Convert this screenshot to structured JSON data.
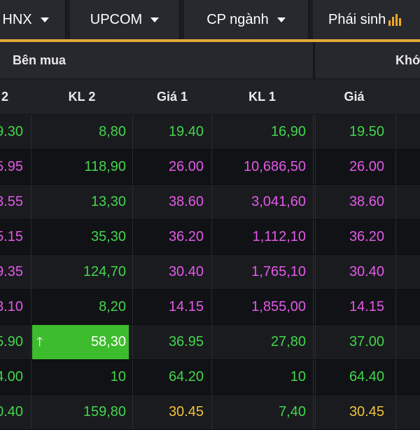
{
  "tabs": [
    {
      "label": "HNX"
    },
    {
      "label": "UPCOM"
    },
    {
      "label": "CP ngành"
    },
    {
      "label": "Phái sinh"
    }
  ],
  "group_headers": {
    "buy": "Bên mua",
    "match": "Khớ"
  },
  "columns": [
    "2",
    "KL 2",
    "Giá 1",
    "KL 1",
    "Giá"
  ],
  "rows": [
    {
      "gia2": "9.30",
      "kl2": "8,80",
      "gia1": "19.40",
      "kl1": "16,90",
      "gia": "19.50",
      "gia2_color": "green",
      "kl2_color": "green",
      "gia1_color": "green",
      "kl1_color": "green",
      "gia_color": "green"
    },
    {
      "gia2": "5.95",
      "kl2": "118,90",
      "gia1": "26.00",
      "kl1": "10,686,50",
      "gia": "26.00",
      "gia2_color": "purple",
      "kl2_color": "green",
      "gia1_color": "purple",
      "kl1_color": "purple",
      "gia_color": "purple"
    },
    {
      "gia2": "3.55",
      "kl2": "13,30",
      "gia1": "38.60",
      "kl1": "3,041,60",
      "gia": "38.60",
      "gia2_color": "purple",
      "kl2_color": "green",
      "gia1_color": "purple",
      "kl1_color": "purple",
      "gia_color": "purple"
    },
    {
      "gia2": "5.15",
      "kl2": "35,30",
      "gia1": "36.20",
      "kl1": "1,112,10",
      "gia": "36.20",
      "gia2_color": "purple",
      "kl2_color": "green",
      "gia1_color": "purple",
      "kl1_color": "purple",
      "gia_color": "purple"
    },
    {
      "gia2": "9.35",
      "kl2": "124,70",
      "gia1": "30.40",
      "kl1": "1,765,10",
      "gia": "30.40",
      "gia2_color": "purple",
      "kl2_color": "green",
      "gia1_color": "purple",
      "kl1_color": "purple",
      "gia_color": "purple"
    },
    {
      "gia2": "3.10",
      "kl2": "8,20",
      "gia1": "14.15",
      "kl1": "1,855,00",
      "gia": "14.15",
      "gia2_color": "purple",
      "kl2_color": "green",
      "gia1_color": "purple",
      "kl1_color": "purple",
      "gia_color": "purple"
    },
    {
      "gia2": "5.90",
      "kl2": "58,30",
      "gia1": "36.95",
      "kl1": "27,80",
      "gia": "37.00",
      "gia2_color": "green",
      "kl2_color": "white",
      "gia1_color": "green",
      "kl1_color": "green",
      "gia_color": "green",
      "highlight": true
    },
    {
      "gia2": "4.00",
      "kl2": "10",
      "gia1": "64.20",
      "kl1": "10",
      "gia": "64.40",
      "gia2_color": "green",
      "kl2_color": "green",
      "gia1_color": "green",
      "kl1_color": "green",
      "gia_color": "green"
    },
    {
      "gia2": "0.40",
      "kl2": "159,80",
      "gia1": "30.45",
      "kl1": "7,40",
      "gia": "30.45",
      "gia2_color": "green",
      "kl2_color": "green",
      "gia1_color": "yellow",
      "kl1_color": "green",
      "gia_color": "yellow"
    }
  ],
  "icons": {
    "dropdown": "chevron-down-icon",
    "chart": "bar-chart-icon",
    "increase": "up-arrow-icon"
  },
  "colors": {
    "accent": "#e1aa3a",
    "up": "#43d64c",
    "ceiling": "#e359e8",
    "reference": "#f0c23a",
    "highlight": "#3dbc2d"
  }
}
